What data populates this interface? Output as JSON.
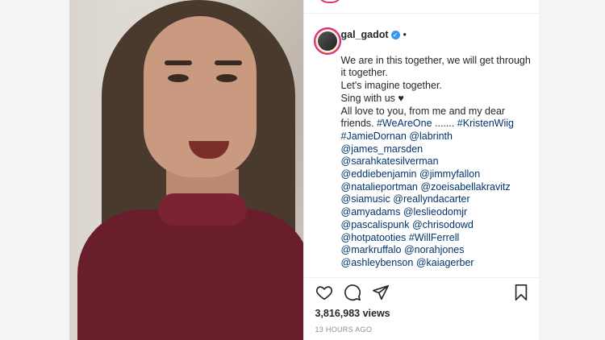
{
  "post": {
    "username": "gal_gadot",
    "verified_glyph": "✓",
    "dot": "•",
    "caption_lines": [
      {
        "text": "We are in this together, we will get through it together.",
        "kind": "text"
      },
      {
        "text": "Let's imagine together.",
        "kind": "text"
      },
      {
        "text": "Sing with us ",
        "kind": "text"
      }
    ],
    "heart_glyph": "♥",
    "love_line": "All love to you, from me and my dear friends. ",
    "hashtag_we_are_one": "#WeAreOne",
    "ellipsis": " ....... ",
    "hashtag_kristen": "#KristenWiig",
    "mentions": [
      "#JamieDornan",
      "@labrinth",
      "@james_marsden",
      "@sarahkatesilverman",
      "@eddiebenjamin",
      "@jimmyfallon",
      "@natalieportman",
      "@zoeisabellakravitz",
      "@siamusic",
      "@reallyndacarter",
      "@amyadams",
      "@leslieodomjr",
      "@pascalispunk",
      "@chrisodowd",
      "@hotpatooties",
      "#WillFerrell",
      "@markruffalo",
      "@norahjones",
      "@ashleybenson",
      "@kaiagerber"
    ],
    "views": "3,816,983 views",
    "timestamp": "13 HOURS AGO"
  },
  "icons": {
    "like": "heart-icon",
    "comment": "comment-icon",
    "share": "share-icon",
    "save": "bookmark-icon"
  },
  "colors": {
    "link": "#003569",
    "verified": "#3897f0",
    "text": "#262626",
    "muted": "#8e8e8e"
  }
}
